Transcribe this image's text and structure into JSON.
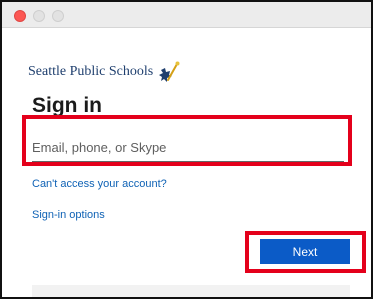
{
  "colors": {
    "accent": "#0b5bc7",
    "link": "#0f62b5",
    "highlight": "#e4001b",
    "brand": "#1f3f6e"
  },
  "window": {
    "controls": [
      "close-icon",
      "minimize-icon",
      "maximize-icon"
    ]
  },
  "brand": {
    "name": "Seattle Public Schools",
    "icon": "seattle-public-schools-logo-icon"
  },
  "signin": {
    "title": "Sign in",
    "input_placeholder": "Email, phone, or Skype",
    "input_value": "",
    "cant_access_link": "Can't access your account?",
    "options_link": "Sign-in options",
    "next_label": "Next"
  }
}
